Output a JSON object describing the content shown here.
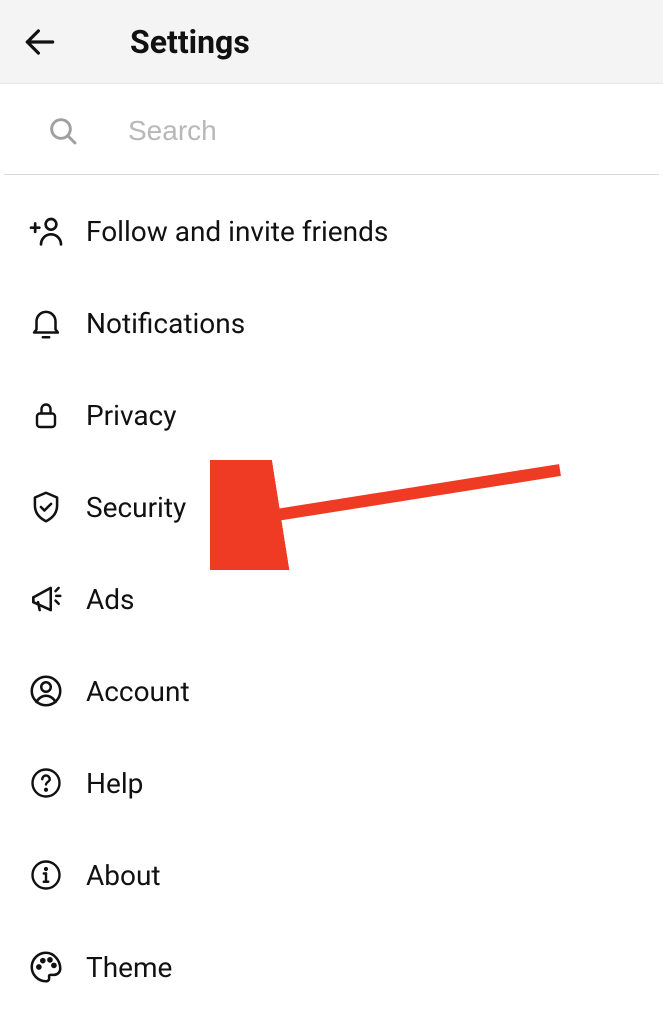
{
  "header": {
    "title": "Settings"
  },
  "search": {
    "placeholder": "Search",
    "value": ""
  },
  "menu": {
    "items": [
      {
        "label": "Follow and invite friends"
      },
      {
        "label": "Notifications"
      },
      {
        "label": "Privacy"
      },
      {
        "label": "Security"
      },
      {
        "label": "Ads"
      },
      {
        "label": "Account"
      },
      {
        "label": "Help"
      },
      {
        "label": "About"
      },
      {
        "label": "Theme"
      }
    ]
  },
  "annotation": {
    "arrow_color": "#ef3b24",
    "points_to": "Security"
  }
}
